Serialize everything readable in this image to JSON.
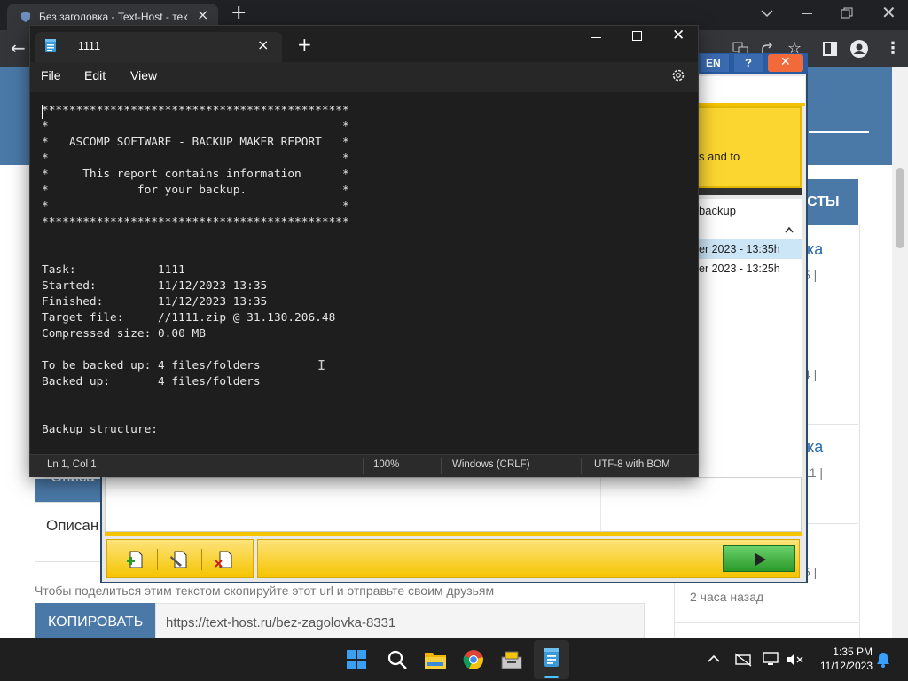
{
  "browser": {
    "tab_title": "Без заголовка - Text-Host - тек",
    "accent": "#202124"
  },
  "webpage": {
    "sidebar_heading_fragment": "СТЫ",
    "items": [
      {
        "title_fragment": "ка",
        "meta": "5 |"
      },
      {
        "meta": "4 |"
      },
      {
        "title_fragment": "ка",
        "meta": "11 |"
      },
      {
        "meta": "5 |"
      }
    ],
    "time_ago": "2 часа назад",
    "button_fragment": "Описа",
    "description_label": "Описан",
    "share_text": "Чтобы поделиться этим текстом скопируйте этот url и отправьте своим друзьям",
    "copy_button": "КОПИРОВАТЬ",
    "url": "https://text-host.ru/bez-zagolovka-8331"
  },
  "backup_maker": {
    "lang_button": "EN",
    "help_button": "?",
    "banner_text": "s and to",
    "list_header": "backup",
    "entries": [
      "er 2023 - 13:35h",
      "er 2023 - 13:25h"
    ],
    "accent": "#f5c400"
  },
  "notepad": {
    "tab_title": "1111",
    "menu": {
      "file": "File",
      "edit": "Edit",
      "view": "View"
    },
    "content": "*********************************************\n*                                           *\n*   ASCOMP SOFTWARE - BACKUP MAKER REPORT   *\n*                                           *\n*     This report contains information      *\n*             for your backup.              *\n*                                           *\n*********************************************\n\n\nTask:            1111\nStarted:         11/12/2023 13:35\nFinished:        11/12/2023 13:35\nTarget file:     //1111.zip @ 31.130.206.48\nCompressed size: 0.00 MB\n\nTo be backed up: 4 files/folders\nBacked up:       4 files/folders\n\n\nBackup structure:",
    "status": {
      "position": "Ln 1, Col 1",
      "zoom": "100%",
      "line_ending": "Windows (CRLF)",
      "encoding": "UTF-8 with BOM"
    }
  },
  "taskbar": {
    "time": "1:35 PM",
    "date": "11/12/2023"
  }
}
